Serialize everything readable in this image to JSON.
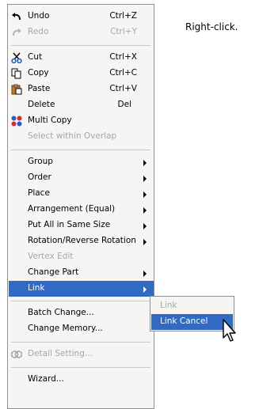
{
  "note": "Right-click.",
  "menu": {
    "undo": {
      "label": "Undo",
      "shortcut": "Ctrl+Z"
    },
    "redo": {
      "label": "Redo",
      "shortcut": "Ctrl+Y"
    },
    "cut": {
      "label": "Cut",
      "shortcut": "Ctrl+X"
    },
    "copy": {
      "label": "Copy",
      "shortcut": "Ctrl+C"
    },
    "paste": {
      "label": "Paste",
      "shortcut": "Ctrl+V"
    },
    "delete": {
      "label": "Delete",
      "shortcut": "Del"
    },
    "multi_copy": {
      "label": "Multi Copy"
    },
    "select_within_overlap": {
      "label": "Select within Overlap"
    },
    "group": {
      "label": "Group"
    },
    "order": {
      "label": "Order"
    },
    "place": {
      "label": "Place"
    },
    "arrangement": {
      "label": "Arrangement (Equal)"
    },
    "same_size": {
      "label": "Put All in Same Size"
    },
    "rotation": {
      "label": "Rotation/Reverse Rotation"
    },
    "vertex_edit": {
      "label": "Vertex Edit"
    },
    "change_part": {
      "label": "Change Part"
    },
    "link": {
      "label": "Link"
    },
    "batch_change": {
      "label": "Batch Change..."
    },
    "change_memory": {
      "label": "Change Memory..."
    },
    "detail_setting": {
      "label": "Detail Setting..."
    },
    "wizard": {
      "label": "Wizard..."
    }
  },
  "submenu": {
    "link": {
      "label": "Link"
    },
    "link_cancel": {
      "label": "Link Cancel"
    }
  },
  "colors": {
    "highlight": "#316ac5",
    "disabled": "#a6a6a6",
    "menu_bg": "#f6f5f3"
  }
}
